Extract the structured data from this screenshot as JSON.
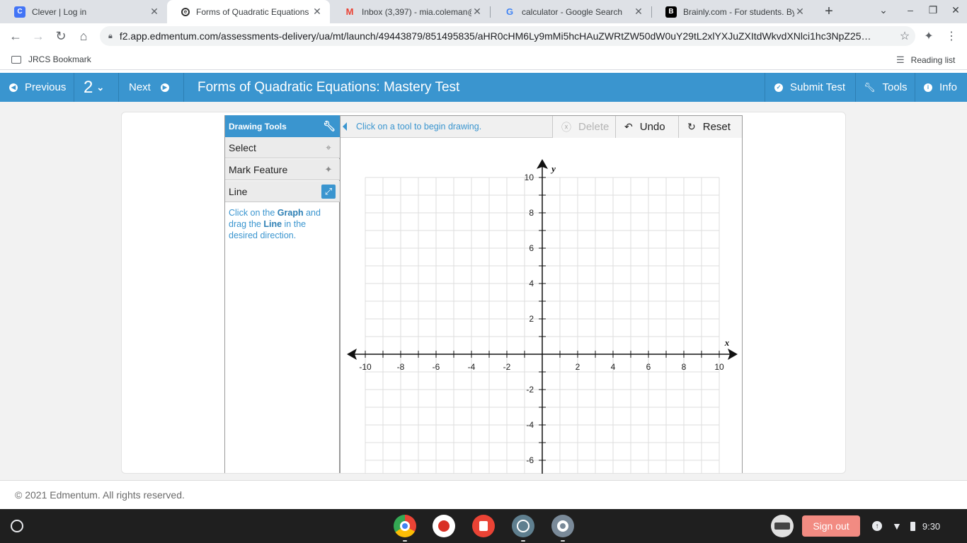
{
  "browser": {
    "tabs": [
      {
        "title": "Clever | Log in",
        "favicon": "C",
        "color": "#4274f6",
        "active": false
      },
      {
        "title": "Forms of Quadratic Equations",
        "favicon": "e",
        "color": "#3a95cf",
        "active": true
      },
      {
        "title": "Inbox (3,397) - mia.coleman@",
        "favicon": "M",
        "color": "#ea4335",
        "active": false
      },
      {
        "title": "calculator - Google Search",
        "favicon": "G",
        "color": "#4285f4",
        "active": false
      },
      {
        "title": "Brainly.com - For students. By",
        "favicon": "B",
        "color": "#000000",
        "active": false
      }
    ],
    "url": "f2.app.edmentum.com/assessments-delivery/ua/mt/launch/49443879/851495835/aHR0cHM6Ly9mMi5hcHAuZWRtZW50dW0uY29tL2xlYXJuZXItdWkvdXNlci1hc3NpZ25…",
    "bookmark": "JRCS Bookmark",
    "reading_list": "Reading list"
  },
  "header": {
    "previous": "Previous",
    "question_number": "2",
    "next": "Next",
    "title": "Forms of Quadratic Equations: Mastery Test",
    "submit": "Submit Test",
    "tools": "Tools",
    "info": "Info"
  },
  "drawing_tools": {
    "heading": "Drawing Tools",
    "items": [
      "Select",
      "Mark Feature",
      "Line"
    ],
    "selected_index": 2,
    "hint": {
      "t1": "Click on the ",
      "b1": "Graph",
      "t2": " and drag the ",
      "b2": "Line",
      "t3": " in the desired direction."
    }
  },
  "graph_toolbar": {
    "message": "Click on a tool to begin drawing.",
    "delete": "Delete",
    "undo": "Undo",
    "reset": "Reset"
  },
  "graph": {
    "x_label": "x",
    "y_label": "y",
    "x_range": [
      -10,
      10
    ],
    "y_range_visible": [
      -6.8,
      10
    ],
    "labeled_x": [
      -10,
      -8,
      -6,
      -4,
      -2,
      2,
      4,
      6,
      8,
      10
    ],
    "labeled_y": [
      10,
      8,
      6,
      4,
      2,
      -2,
      -4,
      -6
    ]
  },
  "footer": {
    "copyright": "© 2021 Edmentum. All rights reserved."
  },
  "shelf": {
    "sign_out": "Sign out",
    "time": "9:30"
  }
}
